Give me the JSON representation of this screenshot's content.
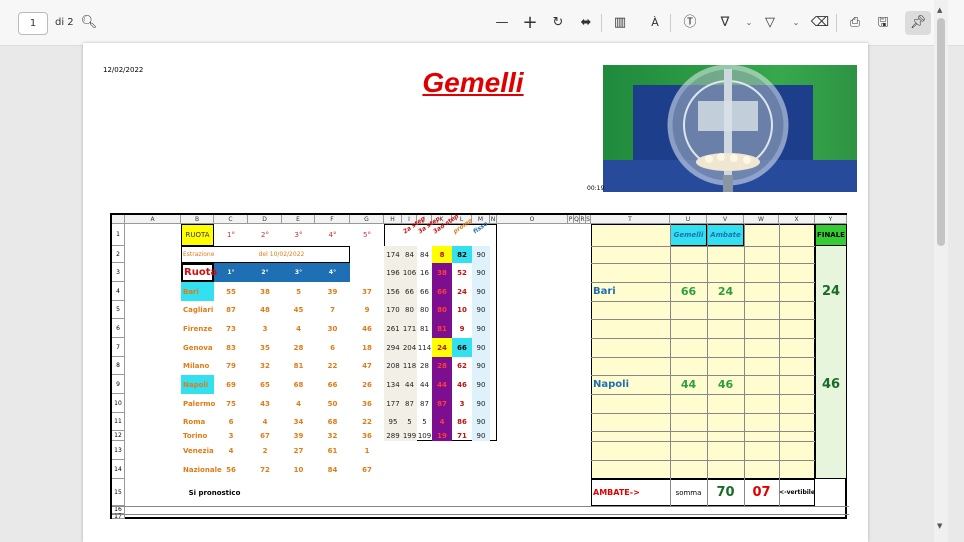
{
  "viewer": {
    "page_number": "1",
    "page_of": "di 2"
  },
  "doc": {
    "date": "12/02/2022",
    "title": "Gemelli",
    "video_time": "00:19"
  },
  "cols": [
    "A",
    "B",
    "C",
    "D",
    "E",
    "F",
    "G",
    "H",
    "I",
    "J",
    "K",
    "L",
    "M",
    "N",
    "O",
    "P",
    "Q",
    "R",
    "S",
    "T",
    "U",
    "V",
    "W",
    "X",
    "Y"
  ],
  "rows": [
    "1",
    "2",
    "3",
    "4",
    "5",
    "6",
    "7",
    "8",
    "9",
    "10",
    "11",
    "12",
    "13",
    "14",
    "15",
    "16",
    "17"
  ],
  "left": {
    "ruota_label": "RUOTA",
    "pos_labels": [
      "1°",
      "2°",
      "3°",
      "4°",
      "5°"
    ],
    "estrazione": "Estrazione",
    "del": "del 10/02/2022",
    "ruota_header": "Ruota",
    "ruota_pos": [
      "1°",
      "2°",
      "3°",
      "4°",
      "5°"
    ],
    "wheels": [
      {
        "name": "Bari",
        "nums": [
          "55",
          "38",
          "5",
          "39",
          "37"
        ]
      },
      {
        "name": "Cagliari",
        "nums": [
          "87",
          "48",
          "45",
          "7",
          "9"
        ]
      },
      {
        "name": "Firenze",
        "nums": [
          "73",
          "3",
          "4",
          "30",
          "46"
        ]
      },
      {
        "name": "Genova",
        "nums": [
          "83",
          "35",
          "28",
          "6",
          "18"
        ]
      },
      {
        "name": "Milano",
        "nums": [
          "79",
          "32",
          "81",
          "22",
          "47"
        ]
      },
      {
        "name": "Napoli",
        "nums": [
          "69",
          "65",
          "68",
          "66",
          "26"
        ]
      },
      {
        "name": "Palermo",
        "nums": [
          "75",
          "43",
          "4",
          "50",
          "36"
        ]
      },
      {
        "name": "Roma",
        "nums": [
          "6",
          "4",
          "34",
          "68",
          "22"
        ]
      },
      {
        "name": "Torino",
        "nums": [
          "3",
          "67",
          "39",
          "32",
          "36"
        ]
      },
      {
        "name": "Venezia",
        "nums": [
          "4",
          "2",
          "27",
          "61",
          "1"
        ]
      },
      {
        "name": "Nazionale",
        "nums": [
          "56",
          "72",
          "10",
          "84",
          "67"
        ]
      }
    ],
    "si_pronostico": "Si pronostico"
  },
  "mid": {
    "diag_labels": [
      "2a step",
      "3a step",
      "3ad step",
      "promo",
      "fisso"
    ],
    "rows": [
      [
        "174",
        "84",
        "84",
        "8",
        "82",
        "90"
      ],
      [
        "196",
        "106",
        "16",
        "38",
        "52",
        "90"
      ],
      [
        "156",
        "66",
        "66",
        "66",
        "24",
        "90"
      ],
      [
        "170",
        "80",
        "80",
        "80",
        "10",
        "90"
      ],
      [
        "261",
        "171",
        "81",
        "81",
        "9",
        "90"
      ],
      [
        "294",
        "204",
        "114",
        "24",
        "66",
        "90"
      ],
      [
        "208",
        "118",
        "28",
        "28",
        "62",
        "90"
      ],
      [
        "134",
        "44",
        "44",
        "44",
        "46",
        "90"
      ],
      [
        "177",
        "87",
        "87",
        "87",
        "3",
        "90"
      ],
      [
        "95",
        "5",
        "5",
        "4",
        "86",
        "90"
      ],
      [
        "289",
        "199",
        "109",
        "19",
        "71",
        "90"
      ]
    ]
  },
  "right": {
    "gemelli": "Gemelli",
    "ambate": "Ambate",
    "finale": "FINALE",
    "bari": "Bari",
    "bari_g": "66",
    "bari_a": "24",
    "finale_1": "24",
    "napoli": "Napoli",
    "napoli_g": "44",
    "napoli_a": "46",
    "finale_2": "46",
    "ambate_lbl": "AMBATE->",
    "somma": "somma",
    "somma_val": "70",
    "conv_val": "07",
    "conv_lbl": "<-vertibile"
  },
  "colors": {
    "accent_red": "#e00000",
    "orange": "#e07b17",
    "purple": "#7b0f8f",
    "blue_header": "#1f6fb5",
    "cyan": "#33e0f0",
    "green_finale": "#33cc33"
  }
}
